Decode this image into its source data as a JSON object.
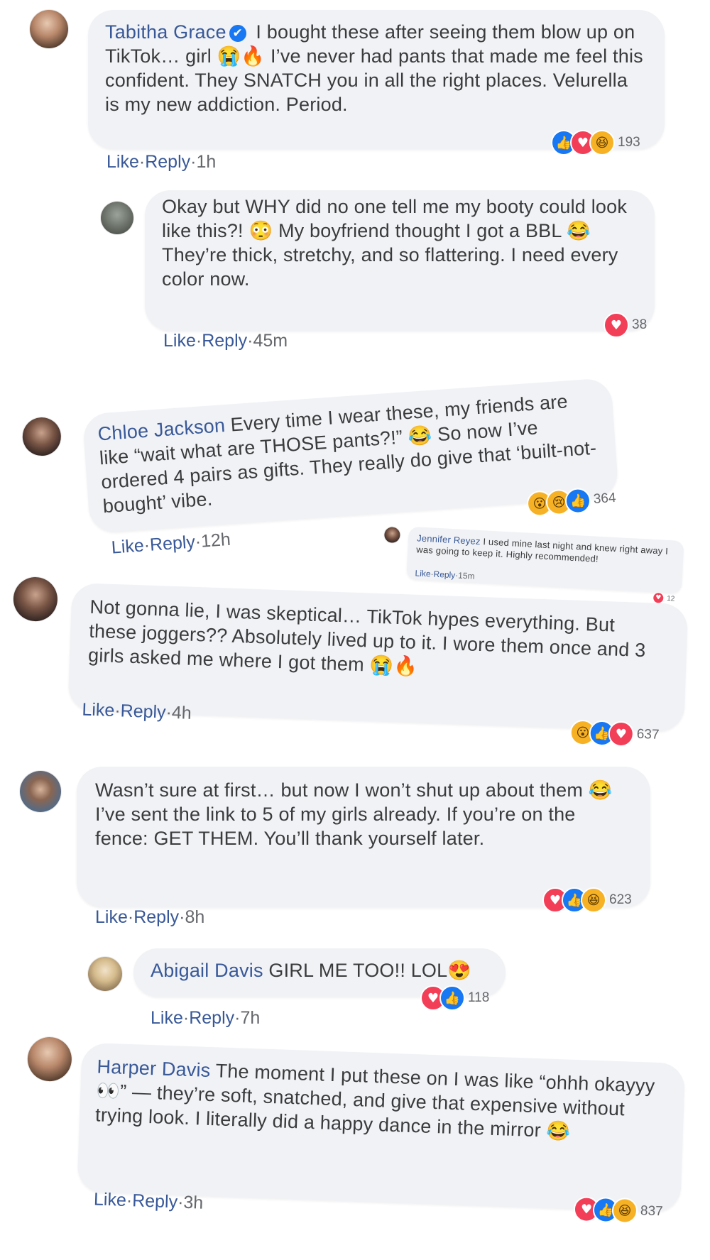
{
  "comments": [
    {
      "name": "Tabitha Grace",
      "text": "I bought these after seeing them blow up on TikTok… girl 😭🔥 I’ve never had pants that made me feel this confident. They SNATCH you in all the right places. Velurella is my new addiction. Period.",
      "like": "Like",
      "sep": "·",
      "reply": "Reply",
      "time": "1h",
      "count": "193",
      "verified_icon": "✔"
    },
    {
      "name": "",
      "text": "Okay but WHY did no one tell me my booty could look like this?! 😳 My boyfriend thought I got a BBL 😂 They’re thick, stretchy, and so flattering. I need every color now.",
      "like": "Like",
      "sep": "·",
      "reply": "Reply",
      "time": "45m",
      "count": "38"
    },
    {
      "name": "Chloe Jackson",
      "text": "Every time I wear these, my friends are like “wait what are THOSE pants?!” 😂 So now I’ve ordered 4 pairs as gifts. They really do give that ‘built-not-bought’ vibe.",
      "like": "Like",
      "sep": "·",
      "reply": "Reply",
      "time": "12h",
      "count": "364"
    },
    {
      "name": "Jennifer Reyez",
      "text": "I used mine last night and knew right away I was going to keep it. Highly recommended!",
      "like": "Like",
      "sep": "·",
      "reply": "Reply",
      "time": "15m",
      "count": "12"
    },
    {
      "name": "",
      "text": "Not gonna lie, I was skeptical… TikTok hypes everything. But these joggers?? Absolutely lived up to it. I wore them once and 3 girls asked me where I got them 😭🔥",
      "like": "Like",
      "sep": "·",
      "reply": "Reply",
      "time": "4h",
      "count": "637"
    },
    {
      "name": "",
      "text": "Wasn’t sure at first… but now I won’t shut up about them 😂 I’ve sent the link to 5 of my girls already. If you’re on the fence: GET THEM. You’ll thank yourself later.",
      "like": "Like",
      "sep": "·",
      "reply": "Reply",
      "time": "8h",
      "count": "623"
    },
    {
      "name": "Abigail Davis",
      "text": "GIRL ME TOO!! LOL😍",
      "like": "Like",
      "sep": "·",
      "reply": "Reply",
      "time": "7h",
      "count": "118"
    },
    {
      "name": "Harper Davis",
      "text": "The moment I put these on I was like “ohhh okayyy 👀” — they’re soft, snatched, and give that expensive without trying look. I literally did a happy dance in the mirror 😂",
      "like": "Like",
      "sep": "·",
      "reply": "Reply",
      "time": "3h",
      "count": "837"
    }
  ],
  "icons": {
    "like": "👍",
    "love": "♥",
    "haha": "😆",
    "wow": "😮",
    "sad": "😢"
  },
  "colors": {
    "name": "#385898",
    "bubble": "#f0f2f5",
    "like": "#1877f2",
    "love": "#f33e58",
    "haha": "#f7b125"
  }
}
